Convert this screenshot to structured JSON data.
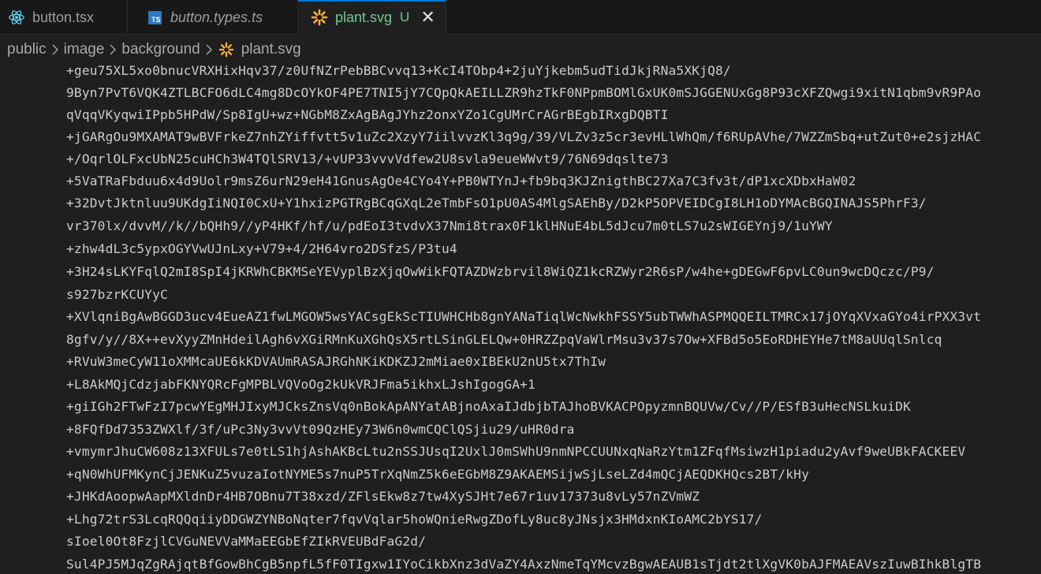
{
  "tabs": [
    {
      "label": "button.tsx",
      "icon": "react-icon",
      "italic": false,
      "active": false
    },
    {
      "label": "button.types.ts",
      "icon": "typescript-icon",
      "italic": true,
      "active": false
    },
    {
      "label": "plant.svg",
      "icon": "svg-file-icon",
      "italic": false,
      "active": true,
      "status": "U",
      "close": "✕"
    }
  ],
  "ts_badge": "TS",
  "breadcrumb": {
    "items": [
      "public",
      "image",
      "background",
      "plant.svg"
    ]
  },
  "colors": {
    "accent": "#0078d4",
    "untracked": "#73c991",
    "react": "#61dafb",
    "typescript": "#3178c6",
    "svg_icon": "#ffb13b"
  },
  "code_lines": [
    "+geu75XL5xo0bnucVRXHixHqv37/z0UfNZrPebBBCvvq13+KcI4TObp4+2juYjkebm5udTidJkjRNa5XKjQ8/",
    "9Byn7PvT6VQK4ZTLBCFO6dLC4mg8DcOYkOF4PE7TNI5jY7CQpQkAEILLZR9hzTkF0NPpmBOMlGxUK0mSJGGENUxGg8P93cXFZQwgi9xitN1qbm9vR9PAo",
    "qVqqVKyqwiIPpb5HPdW/Sp8IgU+wz+NGbM8ZxAgBAgJYhz2onxYZo1CgUMrCrAGrBEgbIRxgDQBTI",
    "+jGARgOu9MXAMAT9wBVFrkeZ7nhZYiffvtt5v1uZc2XzyY7iilvvzKl3q9g/39/VLZv3z5cr3evHLlWhQm/f6RUpAVhe/7WZZmSbq+utZut0+e2sjzHAC",
    "+/OqrlOLFxcUbN25cuHCh3W4TQlSRV13/+vUP33vvvVdfew2U8svla9eueWWvt9/76N69dqslte73",
    "+5VaTRaFbduu6x4d9Uolr9msZ6urN29eH41GnusAgOe4CYo4Y+PB0WTYnJ+fb9bq3KJZnigthBC27Xa7C3fv3t/dP1xcXDbxHaW02",
    "+32DvtJktnluu9UKdgIiNQI0CxU+Y1hxizPGTRgBCqGXqL2eTmbFsO1pU0AS4MlgSAEhBy/D2kP5OPVEIDCgI8LH1oDYMAcBGQINAJS5PhrF3/",
    "vr370lx/dvvM//k//bQHh9//yP4HKf/hf/u/pdEoI3tvdvX37Nmi8trax0F1klHNuE4bL5dJcu7m0tLS7u2sWIGEYnj9/1uYWY",
    "+zhw4dL3c5ypxOGYVwUJnLxy+V79+4/2H64vro2DSfzS/P3tu4",
    "+3H24sLKYFqlQ2mI8SpI4jKRWhCBKMSeYEVyplBzXjqOwWikFQTAZDWzbrvil8WiQZ1kcRZWyr2R6sP/w4he+gDEGwF6pvLC0un9wcDQczc/P9/",
    "s927bzrKCUYyC",
    "+XVlqniBgAwBGGD3ucv4EueAZ1fwLMGOW5wsYACsgEkScTIUWHCHb8gnYANaTiqlWcNwkhFSSY5ubTWWhASPMQQEILTMRCx17jOYqXVxaGYo4irPXX3vt",
    "8gfv/y//8X++evXyyZMnHdeilAgh6vXGiRMnKuXGhQsX5rtLSinGLELQw+0HRZZpqVaWlrMsu3v37s7Ow+XFBd5o5EoRDHEYHe7tM8aUUqlSnlcq",
    "+RVuW3meCyW11oXMMcaUE6kKDVAUmRASAJRGhNKiKDKZJ2mMiae0xIBEkU2nU5tx7ThIw",
    "+L8AkMQjCdzjabFKNYQRcFgMPBLVQVoOg2kUkVRJFma5ikhxLJshIgogGA+1",
    "+giIGh2FTwFzI7pcwYEgMHJIxyMJCksZnsVq0nBokApANYatABjnoAxaIJdbjbTAJhoBVKACPOpyzmnBQUVw/Cv//P/ESfB3uHecNSLkuiDK",
    "+8FQfDd7353ZWXlf/3f/uPc3Ny3vvVt09QzHEy73W6n0wmCQClQSjiu29/uHR0dra",
    "+vmymrJhuCW608z13XFULs7e0tLS1hjAshAKBcLtu2nSSJUsqI2UxlJ0mSWhU9nmNPCCUUNxqNaRzYtm1ZFqfMsiwzH1piadu2yAvf9weUBkFACKEEV",
    "+qN0WhUFMKynCjJENKuZ5vuzaIotNYME5s7nuP5TrXqNmZ5k6eEGbM8Z9AKAEMSijwSjLseLZd4mQCjAEQDKHQcs2BT/kHy",
    "+JHKdAoopwAapMXldnDr4HB7OBnu7T38xzd/ZFlsEkw8z7tw4XySJHt7e67r1uv17373u8vLy57nZVmWZ",
    "+Lhg72trS3LcqRQQqiiyDDGWZYNBoNqter7fqvVqlar5hoWQnieRwgZDofLy8uc8yJNsjx3HMdxnKIoAMC2bYS17/",
    "sIoel0Ot8FzjlCVGuNEVVaMMaEEGbEfZIkRVEUBdFaG2d/",
    "Sul4PJ5MJqZgRAjqtBfGowBhCgB5npfL5fF0TIgxw1IYoCikbXnz3dVaZY4AxzNmeTqYMcvzBgwAEAUB1sTjdt2tlXgVK0bAJFMAEAVszIuwBIhkBlgTB"
  ]
}
